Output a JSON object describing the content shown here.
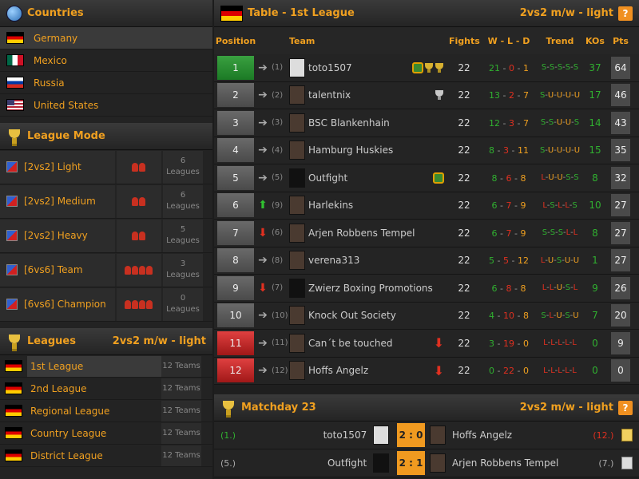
{
  "countries": {
    "title": "Countries",
    "items": [
      {
        "label": "Germany",
        "flag": "de",
        "selected": true
      },
      {
        "label": "Mexico",
        "flag": "mx"
      },
      {
        "label": "Russia",
        "flag": "ru"
      },
      {
        "label": "United States",
        "flag": "us"
      }
    ]
  },
  "league_mode": {
    "title": "League Mode",
    "items": [
      {
        "label": "[2vs2] Light",
        "count": "6",
        "unit": "Leagues"
      },
      {
        "label": "[2vs2] Medium",
        "count": "6",
        "unit": "Leagues"
      },
      {
        "label": "[2vs2] Heavy",
        "count": "5",
        "unit": "Leagues"
      },
      {
        "label": "[6vs6] Team",
        "count": "3",
        "unit": "Leagues"
      },
      {
        "label": "[6vs6] Champion",
        "count": "0",
        "unit": "Leagues"
      }
    ]
  },
  "leagues": {
    "title": "Leagues",
    "mode": "2vs2 m/w - light",
    "items": [
      {
        "label": "1st League",
        "teams": "12 Teams",
        "selected": true
      },
      {
        "label": "2nd League",
        "teams": "12 Teams"
      },
      {
        "label": "Regional League",
        "teams": "12 Teams"
      },
      {
        "label": "Country League",
        "teams": "12 Teams"
      },
      {
        "label": "District League",
        "teams": "12 Teams"
      }
    ]
  },
  "table": {
    "title": "Table - 1st League",
    "mode": "2vs2 m/w - light",
    "headers": {
      "position": "Position",
      "team": "Team",
      "fights": "Fights",
      "wld": "W - L - D",
      "trend": "Trend",
      "kos": "KOs",
      "pts": "Pts"
    },
    "rows": [
      {
        "pos": "1",
        "prev": "(1)",
        "team": "toto1507",
        "fights": "22",
        "w": "21",
        "l": "0",
        "d": "1",
        "trend": "S-S-S-S-S",
        "kos": "37",
        "pts": "64",
        "color": "green",
        "move": "same"
      },
      {
        "pos": "2",
        "prev": "(2)",
        "team": "talentnix",
        "fights": "22",
        "w": "13",
        "l": "2",
        "d": "7",
        "trend": "S-U-U-U-U",
        "kos": "17",
        "pts": "46",
        "color": "grey",
        "move": "same"
      },
      {
        "pos": "3",
        "prev": "(3)",
        "team": "BSC Blankenhain",
        "fights": "22",
        "w": "12",
        "l": "3",
        "d": "7",
        "trend": "S-S-U-U-S",
        "kos": "14",
        "pts": "43",
        "color": "grey",
        "move": "same"
      },
      {
        "pos": "4",
        "prev": "(4)",
        "team": "Hamburg Huskies",
        "fights": "22",
        "w": "8",
        "l": "3",
        "d": "11",
        "trend": "S-U-U-U-U",
        "kos": "15",
        "pts": "35",
        "color": "grey",
        "move": "same"
      },
      {
        "pos": "5",
        "prev": "(5)",
        "team": "Outfight",
        "fights": "22",
        "w": "8",
        "l": "6",
        "d": "8",
        "trend": "L-U-U-S-S",
        "kos": "8",
        "pts": "32",
        "color": "grey",
        "move": "same"
      },
      {
        "pos": "6",
        "prev": "(9)",
        "team": "Harlekins",
        "fights": "22",
        "w": "6",
        "l": "7",
        "d": "9",
        "trend": "L-S-L-L-S",
        "kos": "10",
        "pts": "27",
        "color": "grey",
        "move": "up"
      },
      {
        "pos": "7",
        "prev": "(6)",
        "team": "Arjen Robbens Tempel",
        "fights": "22",
        "w": "6",
        "l": "7",
        "d": "9",
        "trend": "S-S-S-L-L",
        "kos": "8",
        "pts": "27",
        "color": "grey",
        "move": "down"
      },
      {
        "pos": "8",
        "prev": "(8)",
        "team": "verena313",
        "fights": "22",
        "w": "5",
        "l": "5",
        "d": "12",
        "trend": "L-U-S-U-U",
        "kos": "1",
        "pts": "27",
        "color": "grey",
        "move": "same"
      },
      {
        "pos": "9",
        "prev": "(7)",
        "team": "Zwierz Boxing Promotions",
        "fights": "22",
        "w": "6",
        "l": "8",
        "d": "8",
        "trend": "L-L-U-S-L",
        "kos": "9",
        "pts": "26",
        "color": "grey",
        "move": "down"
      },
      {
        "pos": "10",
        "prev": "(10)",
        "team": "Knock Out Society",
        "fights": "22",
        "w": "4",
        "l": "10",
        "d": "8",
        "trend": "S-L-U-S-U",
        "kos": "7",
        "pts": "20",
        "color": "grey",
        "move": "same"
      },
      {
        "pos": "11",
        "prev": "(11)",
        "team": "Can´t be touched",
        "fights": "22",
        "w": "3",
        "l": "19",
        "d": "0",
        "trend": "L-L-L-L-L",
        "kos": "0",
        "pts": "9",
        "color": "red",
        "move": "same"
      },
      {
        "pos": "12",
        "prev": "(12)",
        "team": "Hoffs Angelz",
        "fights": "22",
        "w": "0",
        "l": "22",
        "d": "0",
        "trend": "L-L-L-L-L",
        "kos": "0",
        "pts": "0",
        "color": "red",
        "move": "same"
      }
    ]
  },
  "matchday": {
    "title": "Matchday 23",
    "mode": "2vs2 m/w - light",
    "help_label": "?",
    "matches": [
      {
        "rank_home": "(1.)",
        "home": "toto1507",
        "score": "2 : 0",
        "away": "Hoffs Angelz",
        "rank_away": "(12.)"
      },
      {
        "rank_home": "(5.)",
        "home": "Outfight",
        "score": "2 : 1",
        "away": "Arjen Robbens Tempel",
        "rank_away": "(7.)"
      }
    ]
  }
}
